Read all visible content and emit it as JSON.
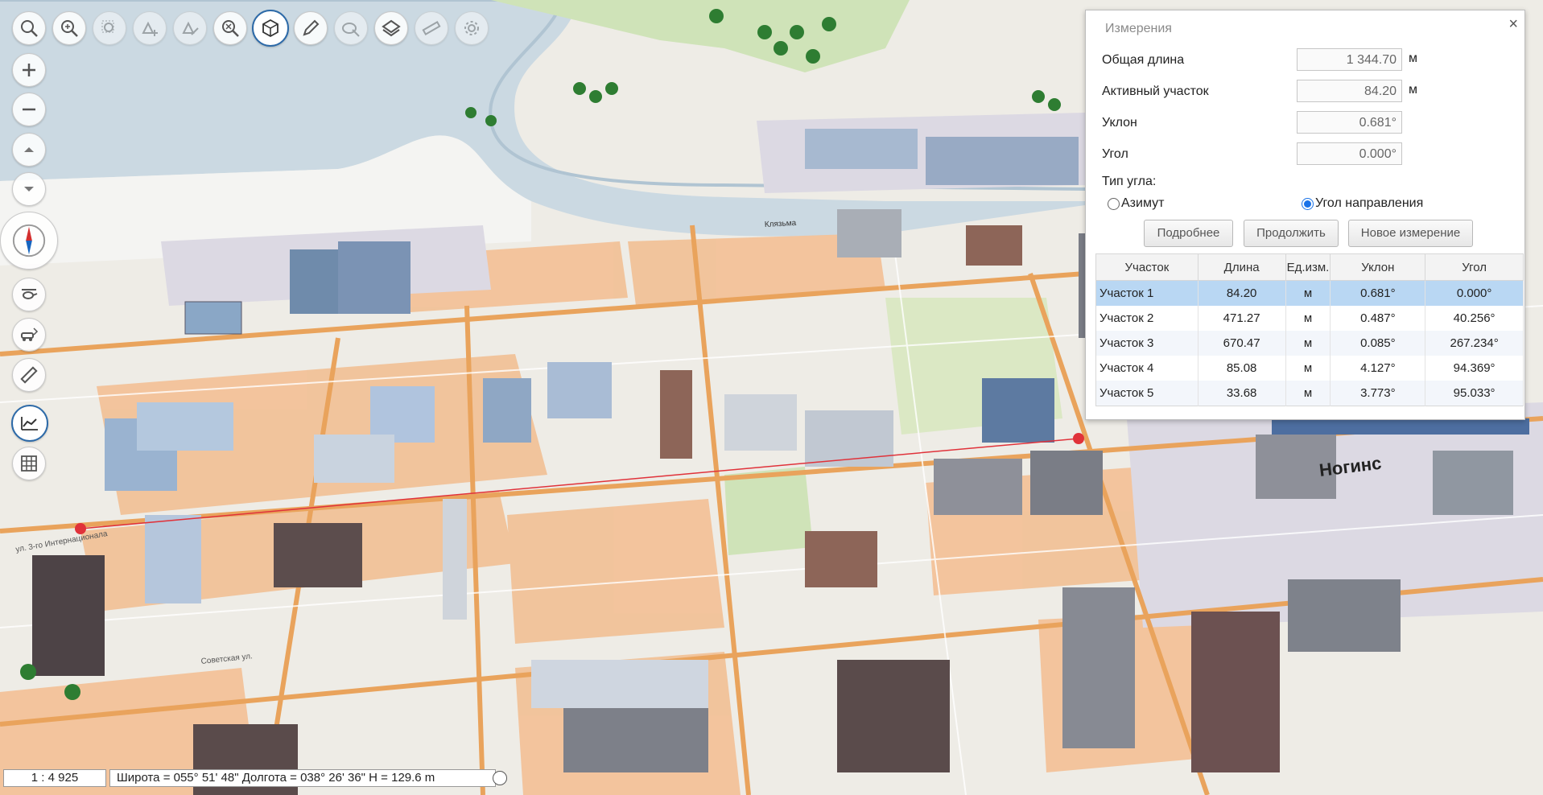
{
  "toolbar": {
    "top_icons": [
      "search-icon",
      "zoom-search-icon",
      "zoom-region-icon",
      "add-object-icon",
      "edit-object-icon",
      "clear-icon",
      "3d-cube-icon",
      "pencil-icon",
      "layers-style-icon",
      "layer-grid-icon",
      "ruler-icon",
      "settings-icon"
    ],
    "side_icons": [
      "zoom-in-icon",
      "zoom-out-icon",
      "tilt-up-icon",
      "tilt-down-icon",
      "compass-icon",
      "helicopter-icon",
      "car-route-icon",
      "ruler-icon",
      "measure-profile-icon",
      "grid-icon"
    ]
  },
  "map": {
    "labels": {
      "city": "Ногинс",
      "street1": "ул. 3-го Интернационала",
      "street2": "Советская ул.",
      "river": "Клязьма"
    },
    "route_color": "#e0323a"
  },
  "panel": {
    "title": "Измерения",
    "close": "×",
    "total_length_label": "Общая длина",
    "total_length_value": "1 344.70",
    "total_length_unit": "м",
    "active_segment_label": "Активный участок",
    "active_segment_value": "84.20",
    "active_segment_unit": "м",
    "slope_label": "Уклон",
    "slope_value": "0.681°",
    "angle_label": "Угол",
    "angle_value": "0.000°",
    "angle_type_label": "Тип угла:",
    "radio_azimuth": "Азимут",
    "radio_direction": "Угол направления",
    "selected_radio": "direction",
    "btn_details": "Подробнее",
    "btn_continue": "Продолжить",
    "btn_new": "Новое измерение",
    "table": {
      "headers": [
        "Участок",
        "Длина",
        "Ед.изм.",
        "Уклон",
        "Угол"
      ],
      "rows": [
        [
          "Участок 1",
          "84.20",
          "м",
          "0.681°",
          "0.000°"
        ],
        [
          "Участок 2",
          "471.27",
          "м",
          "0.487°",
          "40.256°"
        ],
        [
          "Участок 3",
          "670.47",
          "м",
          "0.085°",
          "267.234°"
        ],
        [
          "Участок 4",
          "85.08",
          "м",
          "4.127°",
          "94.369°"
        ],
        [
          "Участок 5",
          "33.68",
          "м",
          "3.773°",
          "95.033°"
        ]
      ],
      "selected_row": 0
    }
  },
  "statusbar": {
    "scale": "1 : 4 925",
    "coords": "Широта = 055° 51' 48\" Долгота = 038° 26' 36\" H = 129.6 m"
  }
}
